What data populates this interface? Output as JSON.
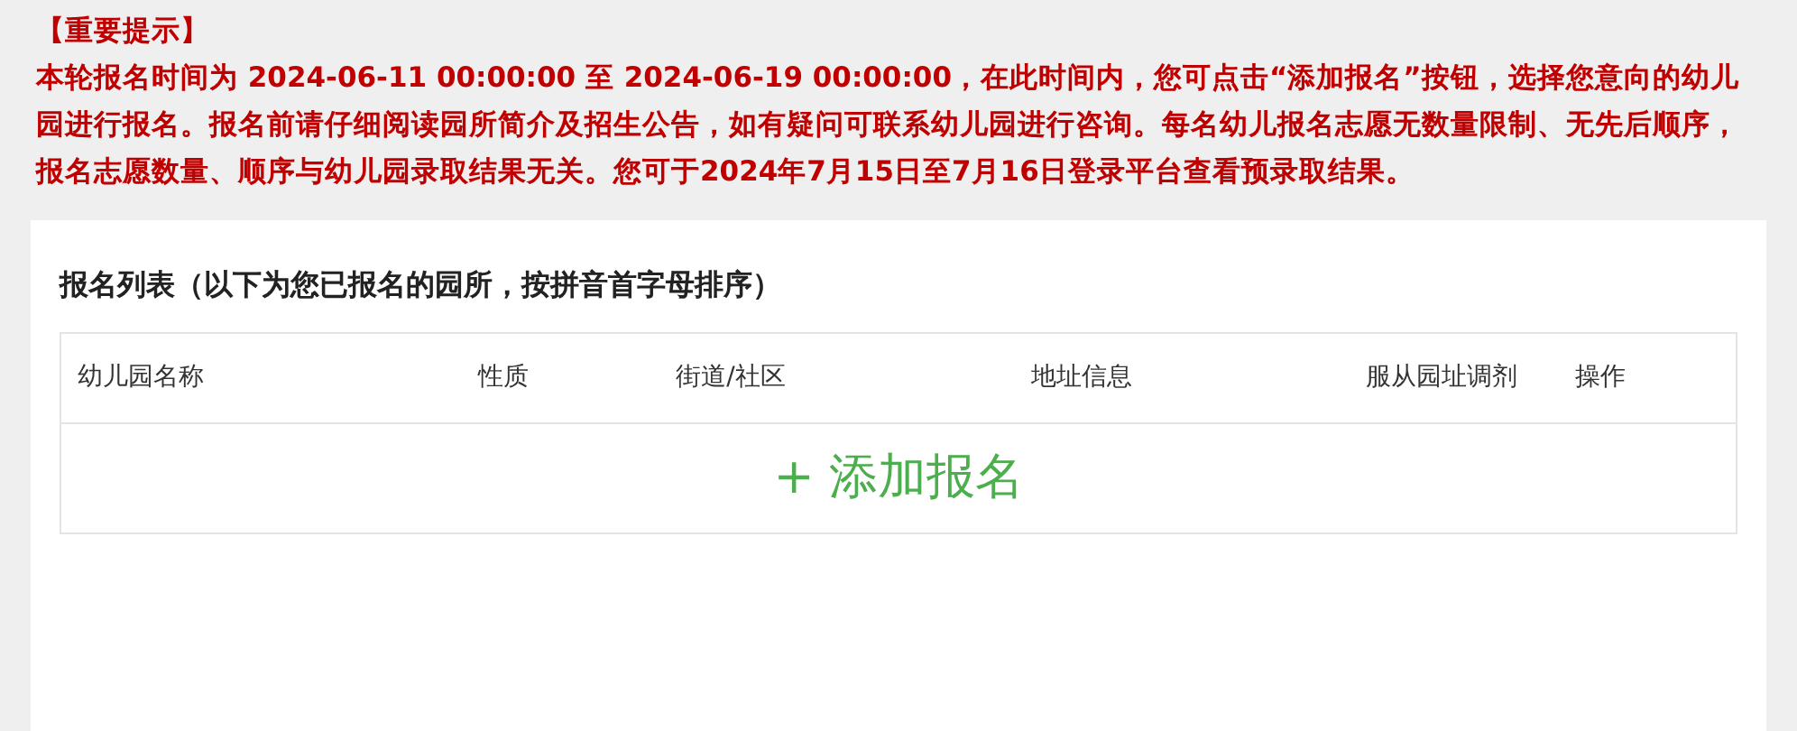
{
  "notice": {
    "title": "【重要提示】",
    "body": "本轮报名时间为 2024-06-11 00:00:00 至 2024-06-19 00:00:00，在此时间内，您可点击“添加报名”按钮，选择您意向的幼儿园进行报名。报名前请仔细阅读园所简介及招生公告，如有疑问可联系幼儿园进行咨询。每名幼儿报名志愿无数量限制、无先后顺序，报名志愿数量、顺序与幼儿园录取结果无关。您可于2024年7月15日至7月16日登录平台查看预录取结果。"
  },
  "list": {
    "title": "报名列表（以下为您已报名的园所，按拼音首字母排序）",
    "columns": [
      "幼儿园名称",
      "性质",
      "街道/社区",
      "地址信息",
      "服从园址调剂",
      "操作"
    ],
    "add_button": {
      "icon": "+",
      "label": "添加报名"
    }
  }
}
